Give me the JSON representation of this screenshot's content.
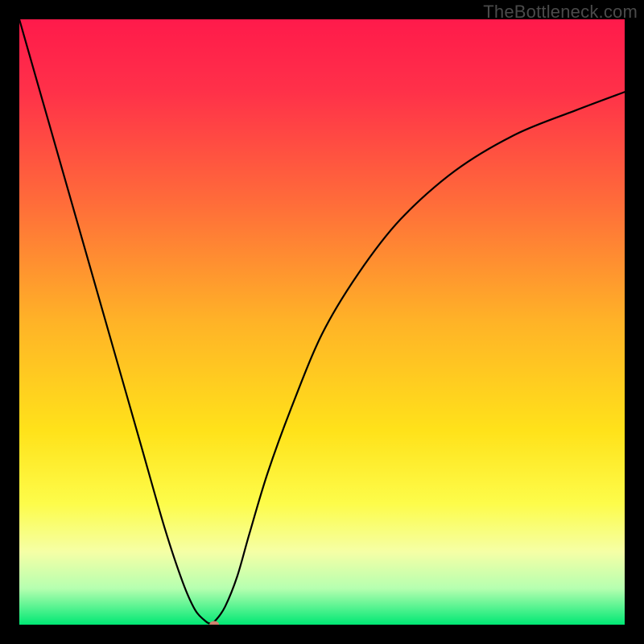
{
  "watermark": "TheBottleneck.com",
  "chart_data": {
    "type": "line",
    "title": "",
    "xlabel": "",
    "ylabel": "",
    "xlim": [
      0,
      100
    ],
    "ylim": [
      0,
      100
    ],
    "grid": false,
    "legend": false,
    "annotations": [],
    "background_gradient": {
      "stops": [
        {
          "pct": 0,
          "color": "#ff1a4b"
        },
        {
          "pct": 12,
          "color": "#ff3149"
        },
        {
          "pct": 30,
          "color": "#ff6b3a"
        },
        {
          "pct": 50,
          "color": "#ffb327"
        },
        {
          "pct": 68,
          "color": "#ffe21a"
        },
        {
          "pct": 80,
          "color": "#fdfc4a"
        },
        {
          "pct": 88,
          "color": "#f5ffa6"
        },
        {
          "pct": 94,
          "color": "#b6ffb0"
        },
        {
          "pct": 100,
          "color": "#00e874"
        }
      ]
    },
    "series": [
      {
        "name": "bottleneck-curve",
        "x": [
          0,
          2,
          5,
          8,
          12,
          16,
          20,
          24,
          27,
          29,
          30.5,
          31.5,
          32.5,
          34,
          36,
          38,
          41,
          45,
          50,
          56,
          63,
          72,
          82,
          92,
          100
        ],
        "y": [
          100,
          93,
          82.5,
          72,
          58,
          44,
          30,
          16,
          7,
          2.5,
          0.8,
          0.2,
          0.8,
          3,
          8,
          15,
          25,
          36,
          48,
          58,
          67,
          75,
          81,
          85,
          88
        ]
      }
    ],
    "markers": [
      {
        "name": "optimum-dot",
        "x": 32.2,
        "y": 0,
        "color": "#d0826f",
        "rx": 6,
        "ry": 4.6
      }
    ]
  }
}
